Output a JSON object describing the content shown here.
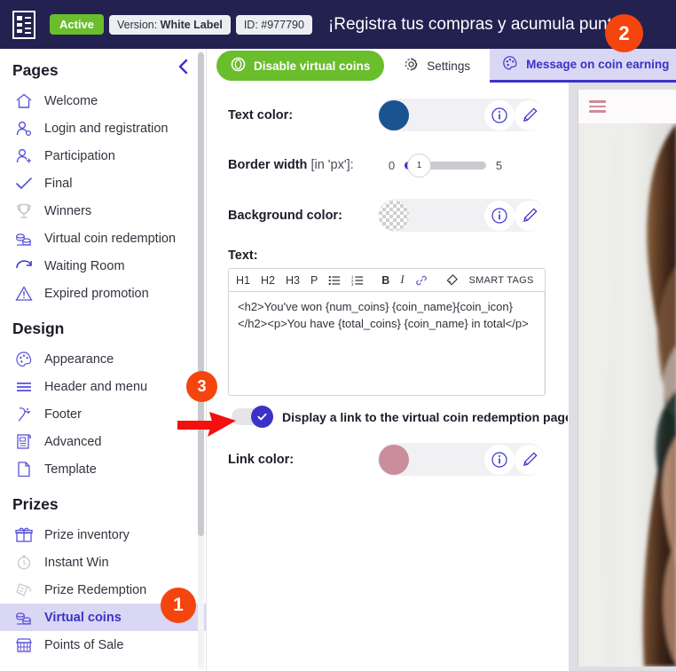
{
  "header": {
    "logo_icon": "receipt-icon",
    "status_badge": "Active",
    "version_prefix": "Version: ",
    "version_value": "White Label",
    "id_label": "ID: #977790",
    "promo_title": "¡Registra tus compras y acumula puntos!",
    "bg_color": "#232150",
    "active_color": "#6abd2b"
  },
  "sidebar": {
    "collapse_icon": "chevron-left-icon",
    "sections": [
      {
        "title": "Pages",
        "items": [
          {
            "label": "Welcome",
            "icon": "home-icon",
            "active": false
          },
          {
            "label": "Login and registration",
            "icon": "user-login-icon",
            "active": false
          },
          {
            "label": "Participation",
            "icon": "user-add-icon",
            "active": false
          },
          {
            "label": "Final",
            "icon": "check-icon",
            "active": false
          },
          {
            "label": "Winners",
            "icon": "trophy-icon",
            "active": false
          },
          {
            "label": "Virtual coin redemption",
            "icon": "coins-icon",
            "active": false
          },
          {
            "label": "Waiting Room",
            "icon": "waiting-icon",
            "active": false
          },
          {
            "label": "Expired promotion",
            "icon": "warning-icon",
            "active": false
          }
        ]
      },
      {
        "title": "Design",
        "items": [
          {
            "label": "Appearance",
            "icon": "palette-icon",
            "active": false
          },
          {
            "label": "Header and menu",
            "icon": "menu-lines-icon",
            "active": false
          },
          {
            "label": "Footer",
            "icon": "footer-icon",
            "active": false
          },
          {
            "label": "Advanced",
            "icon": "scroll-icon",
            "active": false
          },
          {
            "label": "Template",
            "icon": "page-icon",
            "active": false
          }
        ]
      },
      {
        "title": "Prizes",
        "items": [
          {
            "label": "Prize inventory",
            "icon": "gift-icon",
            "active": false
          },
          {
            "label": "Instant Win",
            "icon": "stopwatch-icon",
            "active": false
          },
          {
            "label": "Prize Redemption",
            "icon": "ticket-hand-icon",
            "active": false
          },
          {
            "label": "Virtual coins",
            "icon": "coins-icon",
            "active": true
          },
          {
            "label": "Points of Sale",
            "icon": "store-icon",
            "active": false
          }
        ]
      }
    ]
  },
  "tabs": [
    {
      "label": "Disable virtual coins",
      "icon": "coin-toggle-icon",
      "style": "green",
      "selected": false
    },
    {
      "label": "Settings",
      "icon": "gear-icon",
      "style": "plain",
      "selected": false
    },
    {
      "label": "Message on coin earning",
      "icon": "palette-icon",
      "style": "plain",
      "selected": true
    }
  ],
  "form": {
    "text_color": {
      "label": "Text color:",
      "value": "#1a5490",
      "info_icon": "info-icon",
      "edit_icon": "pencil-icon"
    },
    "border_width": {
      "label_bold": "Border width",
      "label_light": " [in 'px']:",
      "min": "0",
      "max": "5",
      "value": "1"
    },
    "background_color": {
      "label": "Background color:",
      "value": "transparent",
      "info_icon": "info-icon",
      "edit_icon": "pencil-icon"
    },
    "text_editor": {
      "label": "Text:",
      "toolbar": [
        "H1",
        "H2",
        "H3",
        "P"
      ],
      "list_bullet_icon": "bullet-list-icon",
      "list_number_icon": "numbered-list-icon",
      "bold": "B",
      "italic": "I",
      "link_icon": "link-icon",
      "smart_tags_icon": "tag-icon",
      "smart_tags_label": "SMART TAGS",
      "help_icon": "question-icon",
      "content": "<h2>You've won {num_coins} {coin_name}{coin_icon}</h2><p>You have {total_coins} {coin_name} in total</p>"
    },
    "display_link_toggle": {
      "label": "Display a link to the virtual coin redemption page",
      "checked": true,
      "check_icon": "check-icon"
    },
    "link_color": {
      "label": "Link color:",
      "value": "#c98d9b",
      "info_icon": "info-icon",
      "edit_icon": "pencil-icon"
    }
  },
  "preview": {
    "menu_icon": "hamburger-icon",
    "menu_color": "#cf8c98"
  },
  "markers": [
    {
      "number": "1",
      "color": "#f4450f"
    },
    {
      "number": "2",
      "color": "#f4450f"
    },
    {
      "number": "3",
      "color": "#f4450f"
    }
  ]
}
